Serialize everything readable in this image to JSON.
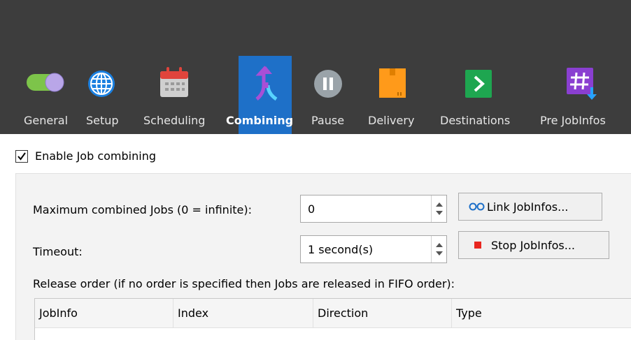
{
  "toolbar": {
    "items": [
      {
        "label": "General",
        "icon": "toggle-icon"
      },
      {
        "label": "Setup",
        "icon": "globe-icon"
      },
      {
        "label": "Scheduling",
        "icon": "calendar-icon"
      },
      {
        "label": "Combining",
        "icon": "merge-arrow-icon"
      },
      {
        "label": "Pause",
        "icon": "pause-icon"
      },
      {
        "label": "Delivery",
        "icon": "box-icon"
      },
      {
        "label": "Destinations",
        "icon": "chevron-right-icon"
      },
      {
        "label": "Pre JobInfos",
        "icon": "hash-download-icon"
      }
    ],
    "active_index": 3,
    "colors": {
      "background": "#3d3d3d",
      "active": "#1e70c8"
    }
  },
  "combining": {
    "enable_label": "Enable Job combining",
    "enabled": true,
    "max_jobs_label": "Maximum combined Jobs (0 = infinite):",
    "max_jobs_value": "0",
    "link_button": "Link JobInfos...",
    "timeout_label": "Timeout:",
    "timeout_value": "1 second(s)",
    "stop_button": "Stop JobInfos...",
    "release_label": "Release order (if no order is specified then Jobs are released in FIFO order):",
    "table": {
      "columns": [
        "JobInfo",
        "Index",
        "Direction",
        "Type"
      ]
    }
  }
}
